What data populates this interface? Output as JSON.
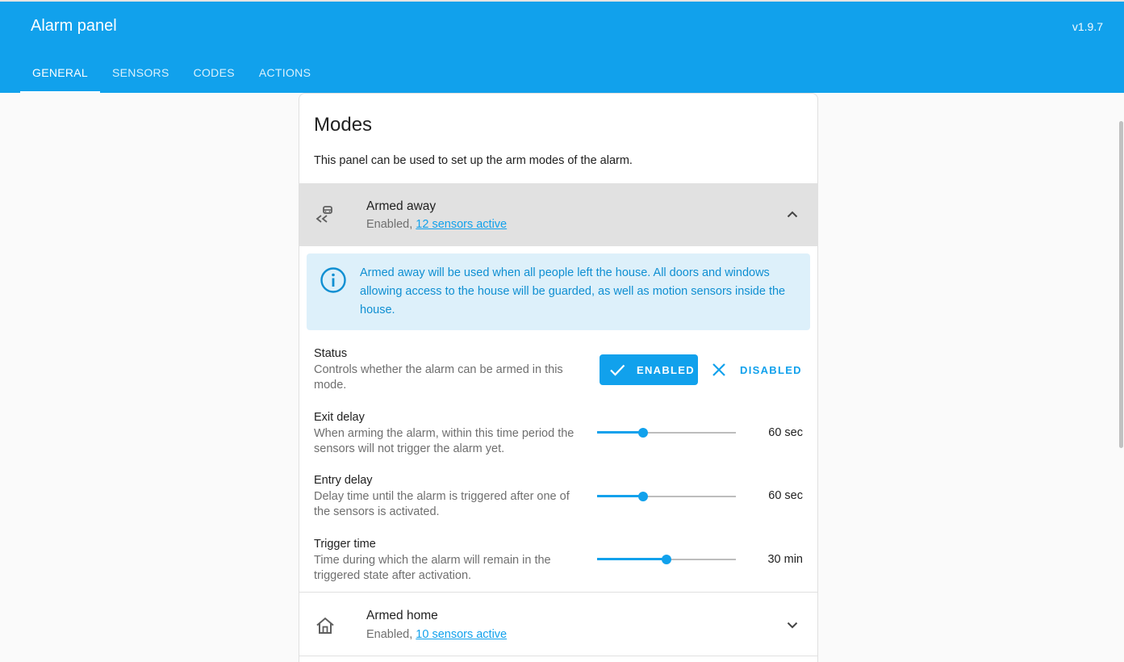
{
  "header": {
    "title": "Alarm panel",
    "version": "v1.9.7",
    "accent_color": "#11a1ec"
  },
  "tabs": [
    {
      "label": "GENERAL",
      "active": true
    },
    {
      "label": "SENSORS",
      "active": false
    },
    {
      "label": "CODES",
      "active": false
    },
    {
      "label": "ACTIONS",
      "active": false
    }
  ],
  "modes_card": {
    "title": "Modes",
    "description": "This panel can be used to set up the arm modes of the alarm."
  },
  "armed_away": {
    "name": "Armed away",
    "status_prefix": "Enabled, ",
    "sensors_link": "12 sensors active",
    "icon": "car-escape-icon",
    "expanded": true,
    "info_text": "Armed away will be used when all people left the house. All doors and windows allowing access to the house will be guarded, as well as motion sensors inside the house.",
    "status": {
      "label": "Status",
      "description": "Controls whether the alarm can be armed in this mode.",
      "enabled_label": "ENABLED",
      "disabled_label": "DISABLED",
      "selected": "enabled"
    },
    "exit_delay": {
      "label": "Exit delay",
      "description": "When arming the alarm, within this time period the sensors will not trigger the alarm yet.",
      "value_text": "60 sec",
      "level": 0.33
    },
    "entry_delay": {
      "label": "Entry delay",
      "description": "Delay time until the alarm is triggered after one of the sensors is activated.",
      "value_text": "60 sec",
      "level": 0.33
    },
    "trigger_time": {
      "label": "Trigger time",
      "description": "Time during which the alarm will remain in the triggered state after activation.",
      "value_text": "30 min",
      "level": 0.5
    }
  },
  "armed_home": {
    "name": "Armed home",
    "status_prefix": "Enabled, ",
    "sensors_link": "10 sensors active",
    "icon": "home-outline-icon",
    "expanded": false
  }
}
